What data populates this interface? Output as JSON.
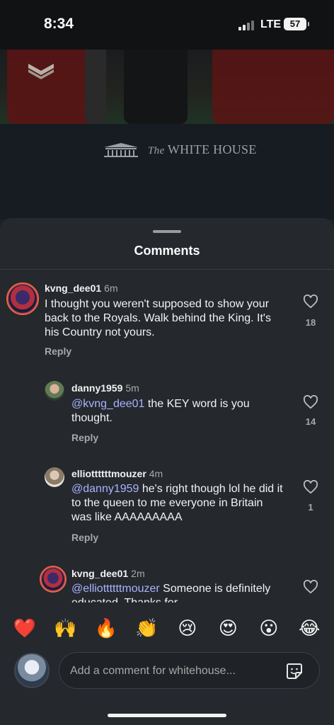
{
  "status": {
    "time": "8:34",
    "network": "LTE",
    "battery": "57"
  },
  "video": {
    "brand_prefix": "The",
    "brand_name": "WHITE HOUSE"
  },
  "sheet": {
    "title": "Comments"
  },
  "comments": [
    {
      "user": "kvng_dee01",
      "age": "6m",
      "mention": "",
      "text": "I thought you weren't supposed to show your back to the Royals. Walk behind the King. It's his Country not yours.",
      "likes": "18",
      "reply_label": "Reply"
    },
    {
      "user": "danny1959",
      "age": "5m",
      "mention": "@kvng_dee01",
      "text": " the KEY word is you thought.",
      "likes": "14",
      "reply_label": "Reply"
    },
    {
      "user": "elliottttttmouzer",
      "age": "4m",
      "mention": "@danny1959",
      "text": " he's right though lol he did it to the queen to me everyone in Britain was like AAAAAAAAA",
      "likes": "1",
      "reply_label": "Reply"
    },
    {
      "user": "kvng_dee01",
      "age": "2m",
      "mention": "@elliottttttmouzer",
      "text": " Someone is definitely educated. Thanks for",
      "likes": "",
      "reply_label": ""
    }
  ],
  "reactions": [
    {
      "emoji": "❤️",
      "name": "red-heart"
    },
    {
      "emoji": "🙌",
      "name": "raising-hands"
    },
    {
      "emoji": "🔥",
      "name": "fire"
    },
    {
      "emoji": "👏",
      "name": "clapping-hands"
    },
    {
      "emoji": "😢",
      "name": "crying-face"
    },
    {
      "emoji": "😍",
      "name": "heart-eyes"
    },
    {
      "emoji": "😮",
      "name": "surprised-face"
    },
    {
      "emoji": "😂",
      "name": "tears-of-joy"
    }
  ],
  "composer": {
    "placeholder": "Add a comment for whitehouse...",
    "icon": "sticker-icon"
  }
}
